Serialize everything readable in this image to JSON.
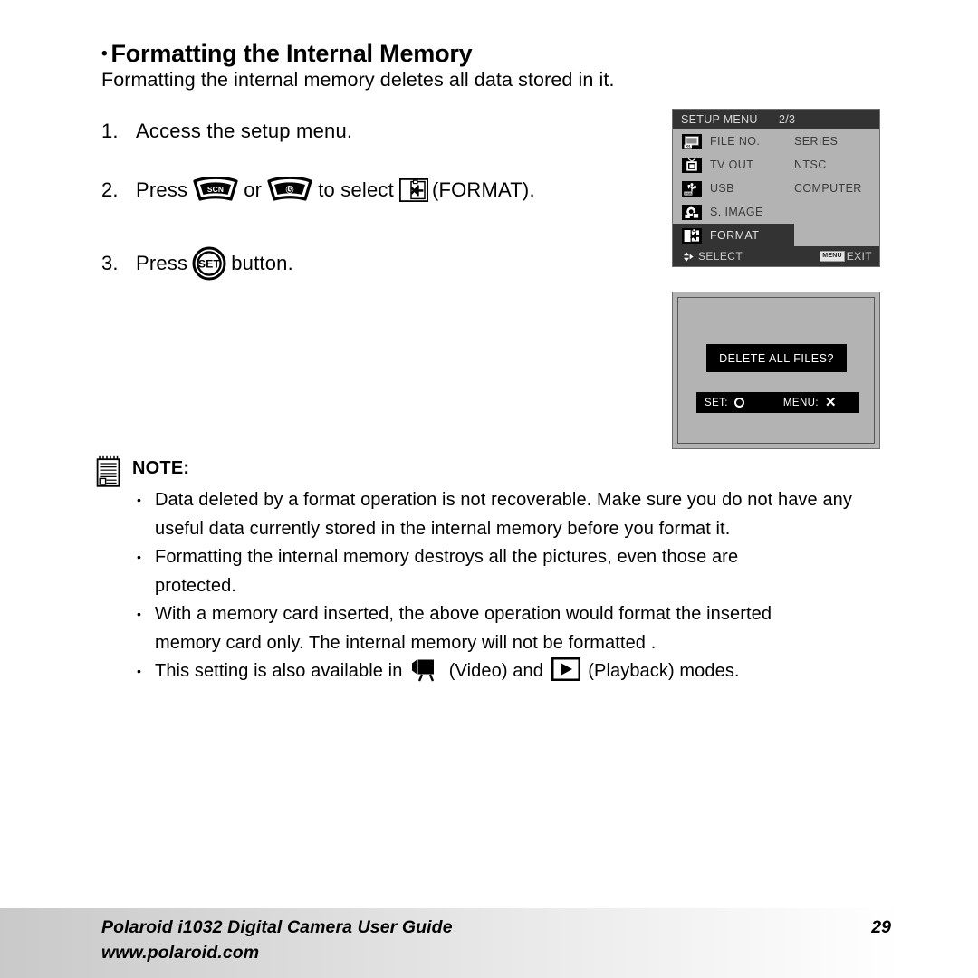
{
  "document": {
    "heading": "Formatting the Internal Memory",
    "heading_bullet": "•",
    "intro": "Formatting the internal memory deletes all data stored in it."
  },
  "steps": [
    {
      "number": "1.",
      "text": "Access the setup menu."
    },
    {
      "number": "2.",
      "text_before": "Press",
      "button_1_label": "SCN",
      "text_mid_1": "or",
      "button_2_icon": "self-timer-icon",
      "text_mid_2": "to select",
      "format_icon": "format-icon",
      "text_after": "(FORMAT)."
    },
    {
      "number": "3.",
      "text_before": "Press",
      "button_label": "SET",
      "text_after": "button."
    }
  ],
  "setup_menu": {
    "title": "SETUP MENU",
    "page_indicator": "2/3",
    "rows": [
      {
        "icon": "file-number-icon",
        "label": "FILE NO.",
        "value": "SERIES",
        "selected": false
      },
      {
        "icon": "tv-out-icon",
        "label": "TV OUT",
        "value": "NTSC",
        "selected": false
      },
      {
        "icon": "usb-icon",
        "label": "USB",
        "value": "COMPUTER",
        "selected": false
      },
      {
        "icon": "s-image-icon",
        "label": "S. IMAGE",
        "value": "",
        "selected": false
      },
      {
        "icon": "format-icon",
        "label": "FORMAT",
        "value": "",
        "selected": true
      }
    ],
    "footer_select": "SELECT",
    "footer_menu_tag": "MENU",
    "footer_exit": "EXIT"
  },
  "delete_dialog": {
    "message": "DELETE ALL FILES?",
    "set_label": "SET:",
    "set_glyph": "circle-glyph",
    "menu_label": "MENU:",
    "menu_glyph": "cross-glyph"
  },
  "note": {
    "icon": "notepad-icon",
    "title": "NOTE:",
    "bullet": "•",
    "items": [
      {
        "line1": "Data deleted by a format operation is not recoverable. Make sure you do not have",
        "line2": "any useful data currently stored in the internal memory before you format it."
      },
      {
        "line1": "Formatting the internal memory destroys all the pictures, even those are",
        "line2": "protected."
      },
      {
        "line1": "With a memory card inserted, the above operation would format the inserted",
        "line2": "memory card only. The internal memory will not be formatted ."
      },
      {
        "text_before": "This setting is also available in",
        "video_icon": "video-mode-icon",
        "text_mid_1": "(Video) and",
        "play_icon": "playback-mode-icon",
        "text_after": "(Playback) modes."
      }
    ]
  },
  "footer": {
    "line1": "Polaroid i1032 Digital Camera User Guide",
    "line2": "www.polaroid.com",
    "page_number": "29"
  }
}
